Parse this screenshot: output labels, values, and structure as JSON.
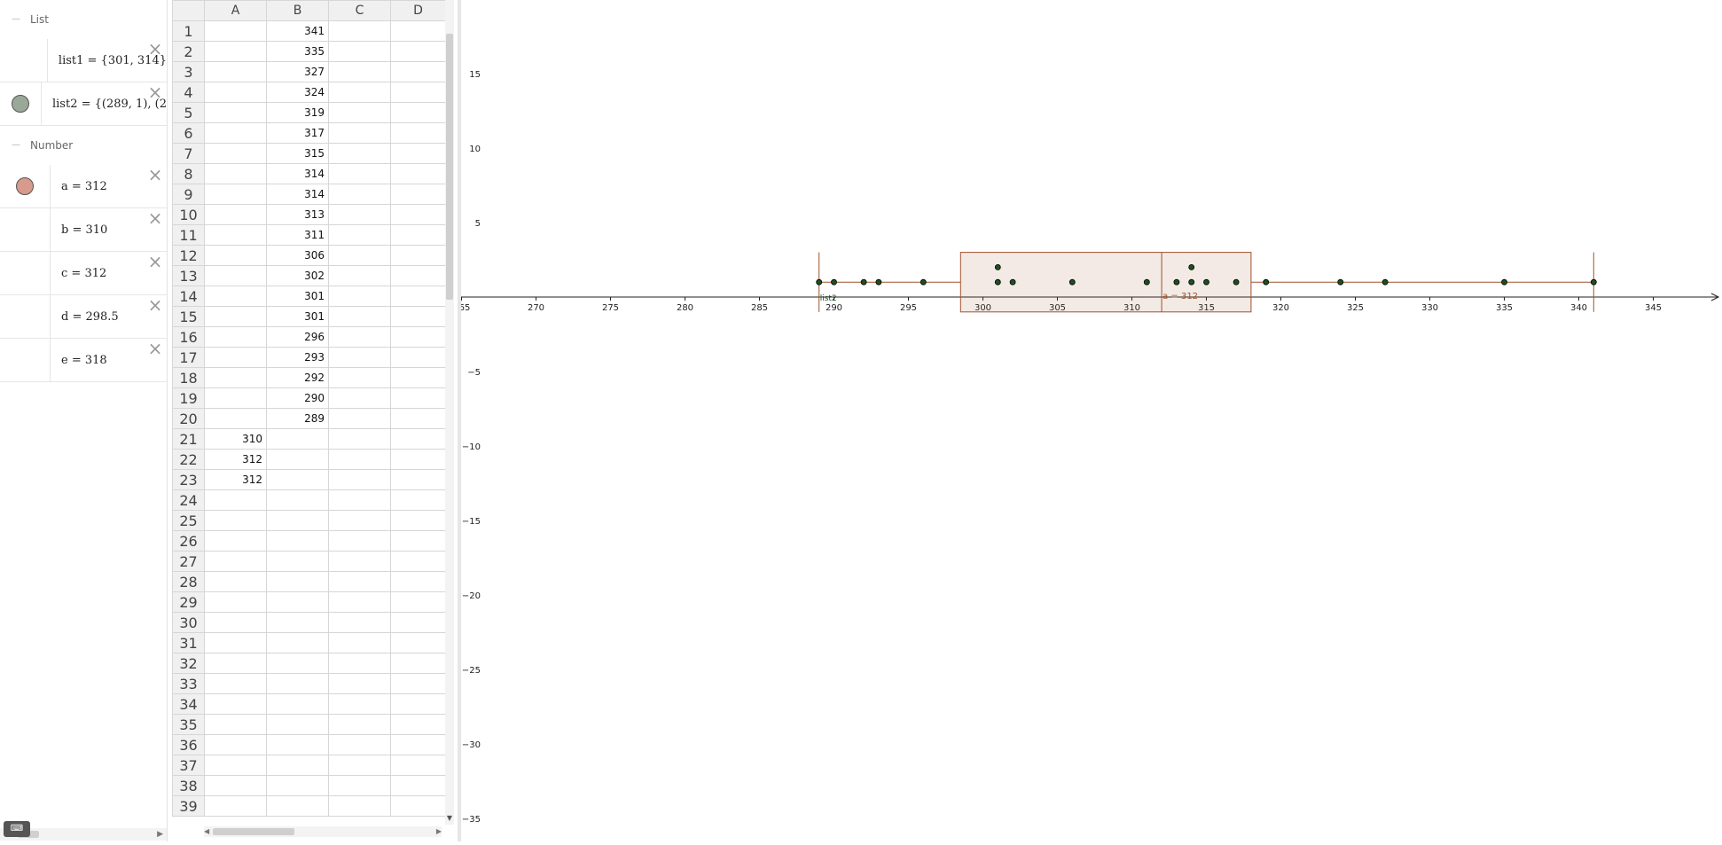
{
  "algebra": {
    "groups": [
      {
        "title": "List",
        "collapse_icon": "minus",
        "items": [
          {
            "expr": "list1 = {301, 314}",
            "color": null
          },
          {
            "expr": "list2 = {(289, 1), (2",
            "color": "#9aa89a"
          }
        ]
      },
      {
        "title": "Number",
        "collapse_icon": "minus",
        "items": [
          {
            "expr": "a = 312",
            "color": "#d79a8c"
          },
          {
            "expr": "b = 310",
            "color": null
          },
          {
            "expr": "c = 312",
            "color": null
          },
          {
            "expr": "d = 298.5",
            "color": null
          },
          {
            "expr": "e = 318",
            "color": null
          }
        ]
      }
    ],
    "keyboard_icon": "keyboard-icon"
  },
  "spreadsheet": {
    "columns": [
      "A",
      "B",
      "C",
      "D"
    ],
    "rows": [
      {
        "n": "1",
        "A": "",
        "B": "341"
      },
      {
        "n": "2",
        "A": "",
        "B": "335"
      },
      {
        "n": "3",
        "A": "",
        "B": "327"
      },
      {
        "n": "4",
        "A": "",
        "B": "324"
      },
      {
        "n": "5",
        "A": "",
        "B": "319"
      },
      {
        "n": "6",
        "A": "",
        "B": "317"
      },
      {
        "n": "7",
        "A": "",
        "B": "315"
      },
      {
        "n": "8",
        "A": "",
        "B": "314"
      },
      {
        "n": "9",
        "A": "",
        "B": "314"
      },
      {
        "n": "10",
        "A": "",
        "B": "313"
      },
      {
        "n": "11",
        "A": "",
        "B": "311"
      },
      {
        "n": "12",
        "A": "",
        "B": "306"
      },
      {
        "n": "13",
        "A": "",
        "B": "302"
      },
      {
        "n": "14",
        "A": "",
        "B": "301"
      },
      {
        "n": "15",
        "A": "",
        "B": "301"
      },
      {
        "n": "16",
        "A": "",
        "B": "296"
      },
      {
        "n": "17",
        "A": "",
        "B": "293"
      },
      {
        "n": "18",
        "A": "",
        "B": "292"
      },
      {
        "n": "19",
        "A": "",
        "B": "290"
      },
      {
        "n": "20",
        "A": "",
        "B": "289"
      },
      {
        "n": "21",
        "A": "310",
        "B": ""
      },
      {
        "n": "22",
        "A": "312",
        "B": ""
      },
      {
        "n": "23",
        "A": "312",
        "B": ""
      },
      {
        "n": "24",
        "A": "",
        "B": ""
      },
      {
        "n": "25",
        "A": "",
        "B": ""
      },
      {
        "n": "26",
        "A": "",
        "B": ""
      },
      {
        "n": "27",
        "A": "",
        "B": ""
      },
      {
        "n": "28",
        "A": "",
        "B": ""
      },
      {
        "n": "29",
        "A": "",
        "B": ""
      },
      {
        "n": "30",
        "A": "",
        "B": ""
      },
      {
        "n": "31",
        "A": "",
        "B": ""
      },
      {
        "n": "32",
        "A": "",
        "B": ""
      },
      {
        "n": "33",
        "A": "",
        "B": ""
      },
      {
        "n": "34",
        "A": "",
        "B": ""
      },
      {
        "n": "35",
        "A": "",
        "B": ""
      },
      {
        "n": "36",
        "A": "",
        "B": ""
      },
      {
        "n": "37",
        "A": "",
        "B": ""
      },
      {
        "n": "38",
        "A": "",
        "B": ""
      },
      {
        "n": "39",
        "A": "",
        "B": ""
      }
    ]
  },
  "graphics": {
    "x_ticks": [
      "65",
      "270",
      "275",
      "280",
      "285",
      "290",
      "295",
      "300",
      "305",
      "310",
      "315",
      "320",
      "325",
      "330",
      "335",
      "340",
      "345"
    ],
    "y_ticks": [
      "15",
      "10",
      "5",
      "−5",
      "−10",
      "−15",
      "−20",
      "−25",
      "−30",
      "−35"
    ],
    "point_color": "#1f4f1f",
    "box_color": "#a0522d",
    "label_a": "a = 312",
    "label_list": "list2"
  },
  "chart_data": {
    "type": "scatter",
    "title": "",
    "xlabel": "",
    "ylabel": "",
    "xlim": [
      264.5,
      349
    ],
    "ylim": [
      -37,
      20
    ],
    "grid": false,
    "points": [
      {
        "x": 289,
        "y": 1
      },
      {
        "x": 290,
        "y": 1
      },
      {
        "x": 292,
        "y": 1
      },
      {
        "x": 293,
        "y": 1
      },
      {
        "x": 296,
        "y": 1
      },
      {
        "x": 301,
        "y": 1
      },
      {
        "x": 301,
        "y": 2
      },
      {
        "x": 302,
        "y": 1
      },
      {
        "x": 306,
        "y": 1
      },
      {
        "x": 311,
        "y": 1
      },
      {
        "x": 313,
        "y": 1
      },
      {
        "x": 314,
        "y": 1
      },
      {
        "x": 314,
        "y": 2
      },
      {
        "x": 315,
        "y": 1
      },
      {
        "x": 317,
        "y": 1
      },
      {
        "x": 319,
        "y": 1
      },
      {
        "x": 324,
        "y": 1
      },
      {
        "x": 327,
        "y": 1
      },
      {
        "x": 335,
        "y": 1
      },
      {
        "x": 341,
        "y": 1
      }
    ],
    "boxplot": {
      "min": 289,
      "q1": 298.5,
      "median": 312,
      "q3": 318,
      "max": 341,
      "y_offset": 1,
      "y_scale": 2
    }
  }
}
